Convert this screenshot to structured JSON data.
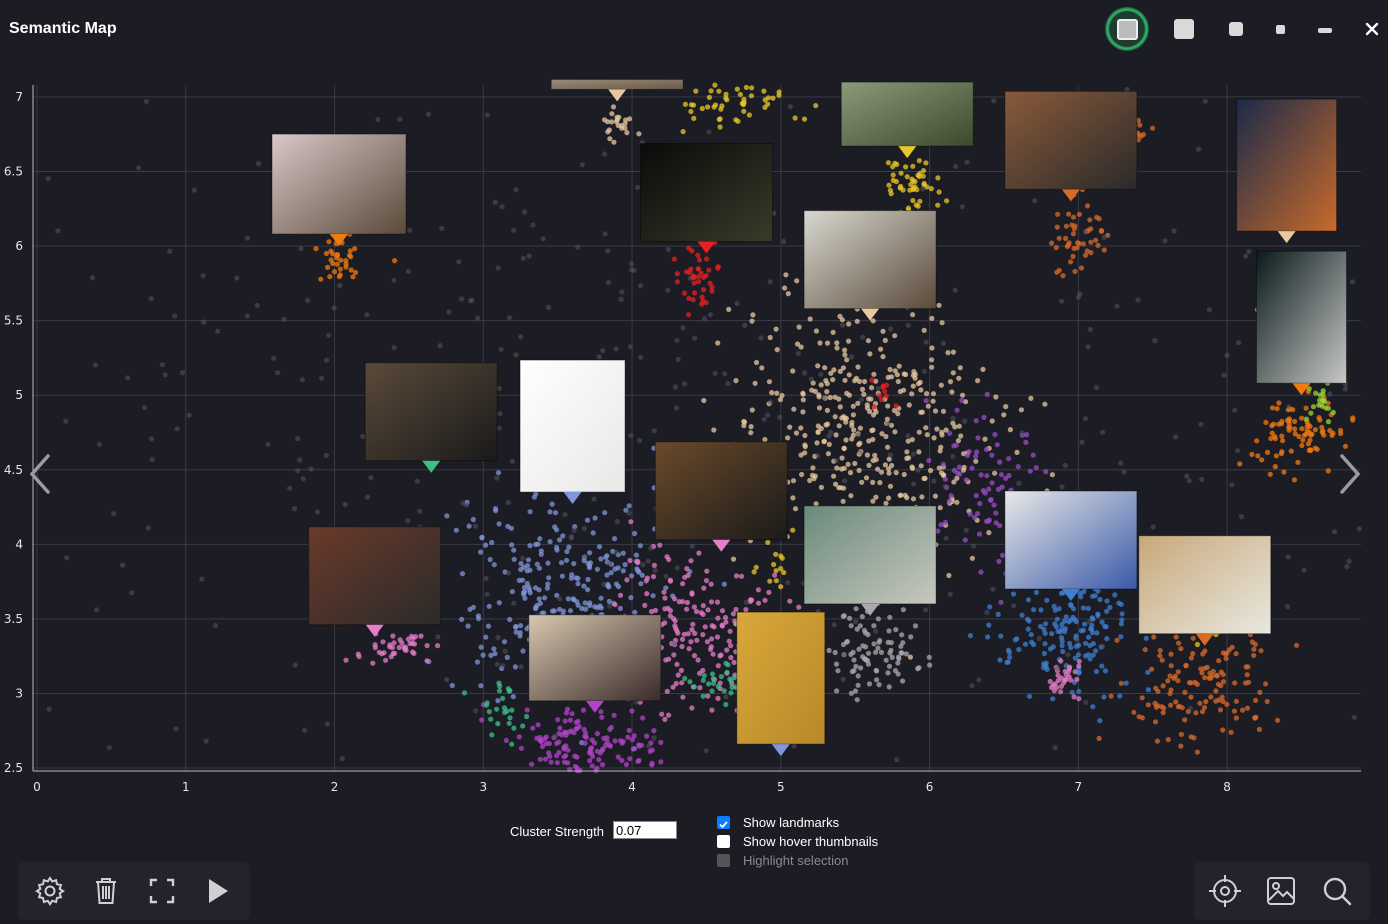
{
  "window": {
    "title": "Semantic Map"
  },
  "window_controls": [
    "view-size-xlarge-icon",
    "view-size-large-icon",
    "view-size-medium-icon",
    "view-size-small-icon",
    "minimize-icon",
    "close-icon"
  ],
  "controls": {
    "cluster_strength_label": "Cluster Strength",
    "cluster_strength_value": "0.07",
    "show_landmarks_label": "Show landmarks",
    "show_landmarks_checked": true,
    "show_hover_thumbnails_label": "Show hover thumbnails",
    "show_hover_thumbnails_checked": false,
    "highlight_selection_label": "Highlight selection",
    "highlight_selection_enabled": false
  },
  "toolbar_left": [
    "settings-icon",
    "trash-icon",
    "fullscreen-icon",
    "play-icon"
  ],
  "toolbar_right": [
    "locate-icon",
    "image-icon",
    "search-icon"
  ],
  "chart_data": {
    "type": "scatter",
    "xlim": [
      0,
      8.9
    ],
    "ylim": [
      2.48,
      7.08
    ],
    "x_ticks": [
      "0",
      "1",
      "2",
      "3",
      "4",
      "5",
      "6",
      "7",
      "8"
    ],
    "y_ticks": [
      "7",
      "6.5",
      "6",
      "5.5",
      "5",
      "4.5",
      "4",
      "3.5",
      "3",
      "2.5"
    ],
    "grid": true,
    "clusters": [
      {
        "color": "#e8c8a0",
        "cx": 5.55,
        "cy": 4.75,
        "sx": 0.45,
        "sy": 0.45,
        "n": 420
      },
      {
        "color": "#7f96d8",
        "cx": 3.5,
        "cy": 3.75,
        "sx": 0.35,
        "sy": 0.35,
        "n": 260
      },
      {
        "color": "#e67ec8",
        "cx": 4.4,
        "cy": 3.4,
        "sx": 0.3,
        "sy": 0.3,
        "n": 200
      },
      {
        "color": "#b043c8",
        "cx": 3.7,
        "cy": 2.65,
        "sx": 0.25,
        "sy": 0.12,
        "n": 140
      },
      {
        "color": "#3d7fd0",
        "cx": 6.95,
        "cy": 3.4,
        "sx": 0.25,
        "sy": 0.2,
        "n": 160
      },
      {
        "color": "#d86a2a",
        "cx": 7.8,
        "cy": 3.1,
        "sx": 0.25,
        "sy": 0.2,
        "n": 140
      },
      {
        "color": "#f07a10",
        "cx": 8.5,
        "cy": 4.75,
        "sx": 0.2,
        "sy": 0.12,
        "n": 90
      },
      {
        "color": "#a9a9ad",
        "cx": 5.6,
        "cy": 3.3,
        "sx": 0.15,
        "sy": 0.15,
        "n": 90
      },
      {
        "color": "#9a4bc8",
        "cx": 6.35,
        "cy": 4.4,
        "sx": 0.2,
        "sy": 0.25,
        "n": 90
      },
      {
        "color": "#e8c828",
        "cx": 5.9,
        "cy": 6.4,
        "sx": 0.1,
        "sy": 0.1,
        "n": 50
      },
      {
        "color": "#e8c828",
        "cx": 4.7,
        "cy": 6.95,
        "sx": 0.2,
        "sy": 0.08,
        "n": 50
      },
      {
        "color": "#d86a2a",
        "cx": 7.0,
        "cy": 6.05,
        "sx": 0.08,
        "sy": 0.12,
        "n": 50
      },
      {
        "color": "#f07a10",
        "cx": 2.05,
        "cy": 5.95,
        "sx": 0.1,
        "sy": 0.08,
        "n": 40
      },
      {
        "color": "#e82020",
        "cx": 4.45,
        "cy": 5.8,
        "sx": 0.07,
        "sy": 0.1,
        "n": 40
      },
      {
        "color": "#e67ec8",
        "cx": 2.4,
        "cy": 3.3,
        "sx": 0.15,
        "sy": 0.04,
        "n": 40
      },
      {
        "color": "#e67ec8",
        "cx": 6.9,
        "cy": 3.1,
        "sx": 0.06,
        "sy": 0.08,
        "n": 30
      },
      {
        "color": "#9ad838",
        "cx": 8.3,
        "cy": 5.65,
        "sx": 0.08,
        "sy": 0.06,
        "n": 24
      },
      {
        "color": "#9ad838",
        "cx": 8.65,
        "cy": 4.95,
        "sx": 0.06,
        "sy": 0.06,
        "n": 20
      },
      {
        "color": "#3dbf8a",
        "cx": 4.6,
        "cy": 3.1,
        "sx": 0.12,
        "sy": 0.06,
        "n": 30
      },
      {
        "color": "#3dbf8a",
        "cx": 3.15,
        "cy": 2.9,
        "sx": 0.1,
        "sy": 0.1,
        "n": 26
      },
      {
        "color": "#e8c8a0",
        "cx": 3.9,
        "cy": 6.8,
        "sx": 0.06,
        "sy": 0.06,
        "n": 22
      },
      {
        "color": "#e82020",
        "cx": 5.7,
        "cy": 5.0,
        "sx": 0.05,
        "sy": 0.05,
        "n": 10
      },
      {
        "color": "#d86a2a",
        "cx": 7.4,
        "cy": 6.75,
        "sx": 0.05,
        "sy": 0.05,
        "n": 16
      },
      {
        "color": "#e8c828",
        "cx": 7.9,
        "cy": 3.45,
        "sx": 0.05,
        "sy": 0.05,
        "n": 16
      },
      {
        "color": "#e8c828",
        "cx": 4.95,
        "cy": 3.9,
        "sx": 0.08,
        "sy": 0.08,
        "n": 14
      },
      {
        "color": "#555560",
        "cx": 4.5,
        "cy": 4.8,
        "sx": 2.6,
        "sy": 1.4,
        "n": 520
      }
    ],
    "landmarks": [
      {
        "x": 2.03,
        "y": 6.0,
        "color": "#f07a10",
        "thumb": "selfie-photo",
        "w": 134,
        "h": 100,
        "bg": [
          "#d8c8c8",
          "#5a4a3a"
        ]
      },
      {
        "x": 3.9,
        "y": 6.97,
        "color": "#e8c8a0",
        "thumb": "building-photo",
        "w": 132,
        "h": 10,
        "bg": [
          "#9a8a7a",
          "#6a5a4a"
        ]
      },
      {
        "x": 4.5,
        "y": 5.95,
        "color": "#e82020",
        "thumb": "palm-night-photo",
        "w": 132,
        "h": 98,
        "bg": [
          "#0a0a0a",
          "#3a3a2a"
        ]
      },
      {
        "x": 5.85,
        "y": 6.59,
        "color": "#e8c828",
        "thumb": "house-photo",
        "w": 132,
        "h": 64,
        "bg": [
          "#8a9a7a",
          "#3a4a2a"
        ]
      },
      {
        "x": 6.95,
        "y": 6.3,
        "color": "#d86a2a",
        "thumb": "carousel-photo",
        "w": 132,
        "h": 98,
        "bg": [
          "#8a5a3a",
          "#2a2a2a"
        ]
      },
      {
        "x": 8.4,
        "y": 6.02,
        "color": "#e8c8a0",
        "thumb": "poster-photo",
        "w": 100,
        "h": 132,
        "bg": [
          "#1a2a4a",
          "#c86a2a"
        ]
      },
      {
        "x": 8.5,
        "y": 5.0,
        "color": "#f07a10",
        "thumb": "vertical-night-photo",
        "w": 90,
        "h": 132,
        "bg": [
          "#0a1a1a",
          "#c8c8c8"
        ]
      },
      {
        "x": 5.6,
        "y": 5.5,
        "color": "#e8c8a0",
        "thumb": "chains-photo",
        "w": 132,
        "h": 98,
        "bg": [
          "#d8d8d0",
          "#5a4a3a"
        ]
      },
      {
        "x": 2.65,
        "y": 4.48,
        "color": "#3dbf8a",
        "thumb": "presentation-photo",
        "w": 132,
        "h": 98,
        "bg": [
          "#5a4a3a",
          "#1a1a1a"
        ]
      },
      {
        "x": 3.6,
        "y": 4.27,
        "color": "#7f96d8",
        "thumb": "receipt-document",
        "w": 105,
        "h": 132,
        "bg": [
          "#ffffff",
          "#e8e8e8"
        ]
      },
      {
        "x": 4.6,
        "y": 3.95,
        "color": "#e67ec8",
        "thumb": "lantern-photo",
        "w": 132,
        "h": 98,
        "bg": [
          "#6a4a2a",
          "#1a1a1a"
        ]
      },
      {
        "x": 5.6,
        "y": 3.52,
        "color": "#a9a9ad",
        "thumb": "room-photo",
        "w": 132,
        "h": 98,
        "bg": [
          "#6a8a7a",
          "#c8c8c0"
        ]
      },
      {
        "x": 6.95,
        "y": 3.62,
        "color": "#3d7fd0",
        "thumb": "kids-craft-photo",
        "w": 132,
        "h": 98,
        "bg": [
          "#e8e8e8",
          "#3a5aa8"
        ]
      },
      {
        "x": 7.85,
        "y": 3.32,
        "color": "#d86a2a",
        "thumb": "kids-table-photo",
        "w": 132,
        "h": 98,
        "bg": [
          "#c8a87a",
          "#e8e8e0"
        ]
      },
      {
        "x": 2.27,
        "y": 3.38,
        "color": "#e67ec8",
        "thumb": "boardgame-photo",
        "w": 132,
        "h": 98,
        "bg": [
          "#6a3a2a",
          "#2a2a2a"
        ]
      },
      {
        "x": 3.75,
        "y": 2.87,
        "color": "#b043c8",
        "thumb": "table-mess-photo",
        "w": 132,
        "h": 86,
        "bg": [
          "#d8c8b0",
          "#3a2a2a"
        ]
      },
      {
        "x": 5.0,
        "y": 2.58,
        "color": "#7f96d8",
        "thumb": "yellow-wall-photo",
        "w": 88,
        "h": 132,
        "bg": [
          "#d8a83a",
          "#b8882a"
        ]
      }
    ]
  }
}
